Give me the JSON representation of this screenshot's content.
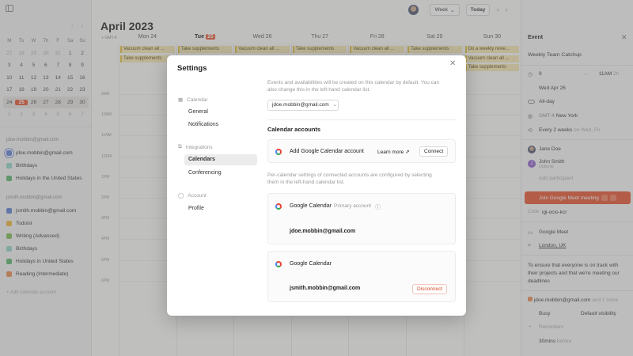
{
  "sidebar": {
    "mini_calendar": {
      "weekdays": [
        "M",
        "Tu",
        "W",
        "Th",
        "F",
        "Sa",
        "Su"
      ],
      "weeks": [
        [
          "27",
          "28",
          "29",
          "30",
          "31",
          "1",
          "2"
        ],
        [
          "3",
          "4",
          "5",
          "6",
          "7",
          "8",
          "9"
        ],
        [
          "10",
          "11",
          "12",
          "13",
          "14",
          "15",
          "16"
        ],
        [
          "17",
          "18",
          "19",
          "20",
          "21",
          "22",
          "23"
        ],
        [
          "24",
          "25",
          "26",
          "27",
          "28",
          "29",
          "30"
        ],
        [
          "1",
          "2",
          "3",
          "4",
          "5",
          "6",
          "7"
        ]
      ],
      "today": "25"
    },
    "accounts": [
      {
        "email": "jdoe.mobbin@gmail.com",
        "calendars": [
          {
            "name": "jdoe.mobbin@gmail.com",
            "color": "#5b7fd0",
            "selected": true
          },
          {
            "name": "Birthdays",
            "color": "#8fd3c7"
          },
          {
            "name": "Holidays in the United States",
            "color": "#57b36b"
          }
        ]
      },
      {
        "email": "jsmith.mobbin@gmail.com",
        "calendars": [
          {
            "name": "jsmith.mobbin@gmail.com",
            "color": "#5b7fd0"
          },
          {
            "name": "Todoist",
            "color": "#f0b43a"
          },
          {
            "name": "Writing (Advanced)",
            "color": "#7cbb4f"
          },
          {
            "name": "Birthdays",
            "color": "#8fd3c7"
          },
          {
            "name": "Holidays in United States",
            "color": "#57b36b"
          },
          {
            "name": "Reading (Intermediate)",
            "color": "#e98b4e"
          }
        ]
      }
    ],
    "add_calendar": "Add calendar account"
  },
  "main": {
    "month": "April 2023",
    "view": "Week",
    "today_button": "Today",
    "timezone": "GMT-4",
    "days": [
      {
        "dow": "Mon",
        "num": "24"
      },
      {
        "dow": "Tue",
        "num": "25",
        "today": true
      },
      {
        "dow": "Wed",
        "num": "26"
      },
      {
        "dow": "Thu",
        "num": "27"
      },
      {
        "dow": "Fri",
        "num": "28"
      },
      {
        "dow": "Sat",
        "num": "29"
      },
      {
        "dow": "Sun",
        "num": "30"
      }
    ],
    "hours": [
      "9AM",
      "10AM",
      "11AM",
      "12PM",
      "1PM",
      "2PM",
      "3PM",
      "4PM",
      "5PM",
      "6PM"
    ],
    "events": [
      {
        "day": 0,
        "row": 0,
        "title": "Vacuum clean all ..."
      },
      {
        "day": 0,
        "row": 1,
        "title": "Take supplements"
      },
      {
        "day": 1,
        "row": 0,
        "title": "Take supplements"
      },
      {
        "day": 2,
        "row": 0,
        "title": "Vacuum clean all ..."
      },
      {
        "day": 3,
        "row": 0,
        "title": "Take supplements"
      },
      {
        "day": 4,
        "row": 0,
        "title": "Vacuum clean all ..."
      },
      {
        "day": 5,
        "row": 0,
        "title": "Take supplements"
      },
      {
        "day": 6,
        "row": 0,
        "title": "Do a weekly revie..."
      },
      {
        "day": 6,
        "row": 1,
        "title": "Vacuum clean all ..."
      },
      {
        "day": 6,
        "row": 2,
        "title": "Take supplements"
      }
    ]
  },
  "event_panel": {
    "heading": "Event",
    "title": "Weekly Team Catchup",
    "time_from": "9",
    "time_to": "11AM",
    "duration": "2h",
    "date": "Wed Apr 26",
    "all_day": "All-day",
    "timezone": "GMT-4",
    "timezone_city": "New York",
    "recurrence": "Every 2 weeks",
    "recurrence_detail": "on Wed, Fri",
    "participants": [
      {
        "name": "Jane Doe",
        "note": ""
      },
      {
        "name": "John Smith",
        "note": "Optional",
        "initial": "J"
      }
    ],
    "add_participant": "Add participant",
    "meet_button": "Join Google Meet meeting",
    "code_label": "Code",
    "code": "igi-ocio-kcr",
    "conferencing": "Google Meet",
    "location": "London, UK",
    "description": [
      "To ensure that everyone is on track with",
      "their projects and that we're meeting our",
      "deadlines"
    ],
    "organizer": "jdoe.mobbin@gmail.com",
    "organizer_more": "and 1 more",
    "busy": "Busy",
    "visibility": "Default visibility",
    "reminders_label": "Reminders",
    "reminder": "30mins",
    "reminder_suffix": "before"
  },
  "settings": {
    "title": "Settings",
    "nav": [
      {
        "group": "Calendar",
        "items": [
          "General",
          "Notifications"
        ]
      },
      {
        "group": "Integrations",
        "items": [
          "Calendars",
          "Conferencing"
        ]
      },
      {
        "group": "Account",
        "items": [
          "Profile"
        ]
      }
    ],
    "active_item": "Calendars",
    "default_desc": [
      "Events and availabilities will be created on this calendar by default. You can",
      "also change this in the left-hand calendar list."
    ],
    "default_calendar": "jdoe.mobbin@gmail.com",
    "accounts_heading": "Calendar accounts",
    "add_google_label": "Add Google Calendar account",
    "learn_more": "Learn more",
    "connect": "Connect",
    "per_calendar_desc": [
      "Per-calendar settings of connected accounts are configured by selecting",
      "them in the left-hand calendar list."
    ],
    "connected": [
      {
        "label": "Google Calendar",
        "tag": "Primary account",
        "email": "jdoe.mobbin@gmail.com"
      },
      {
        "label": "Google Calendar",
        "email": "jsmith.mobbin@gmail.com",
        "action": "Disconnect"
      }
    ]
  }
}
